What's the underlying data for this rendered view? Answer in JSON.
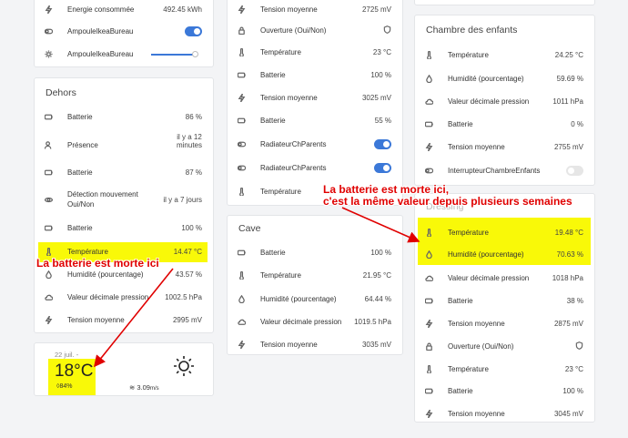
{
  "annotations": {
    "left": "La batterie est morte ici",
    "right_line1": "La batterie est morte ici,",
    "right_line2": "c'est la même valeur depuis plusieurs semaines"
  },
  "col1_top": [
    {
      "icon": "bolt-icon",
      "label": "Energie consommée",
      "value": "492.45 kWh"
    },
    {
      "icon": "toggle-icon",
      "label": "AmpouleIkeaBureau",
      "toggle": "on"
    },
    {
      "icon": "sun-icon",
      "label": "AmpouleIkeaBureau",
      "slider": true
    }
  ],
  "dehors": {
    "title": "Dehors",
    "rows": [
      {
        "icon": "battery-icon",
        "label": "Batterie",
        "value": "86 %"
      },
      {
        "icon": "people-icon",
        "label": "Présence",
        "value1": "il y a 12",
        "value2": "minutes"
      },
      {
        "icon": "battery-icon",
        "label": "Batterie",
        "value": "87 %"
      },
      {
        "icon": "eye-icon",
        "label1": "Détection mouvement",
        "label2": "Oui/Non",
        "value": "il y a 7 jours"
      },
      {
        "icon": "battery-icon",
        "label": "Batterie",
        "value": "100 %"
      },
      {
        "icon": "thermometer-icon",
        "label": "Température",
        "value": "14.47 °C"
      },
      {
        "icon": "drop-icon",
        "label": "Humidité (pourcentage)",
        "value": "43.57 %"
      },
      {
        "icon": "cloud-icon",
        "label": "Valeur décimale pression",
        "value": "1002.5 hPa"
      },
      {
        "icon": "bolt-icon",
        "label": "Tension moyenne",
        "value": "2995 mV"
      }
    ]
  },
  "weather": {
    "date": "22 juil. -",
    "temp": "18°C",
    "humidity": "84%",
    "wind": "3.09",
    "wind_unit": "m/s"
  },
  "col2_top": [
    {
      "icon": "bolt-icon",
      "label": "Tension moyenne",
      "value": "2725 mV"
    },
    {
      "icon": "lock-icon",
      "label": "Ouverture (Oui/Non)",
      "shield": true
    },
    {
      "icon": "thermometer-icon",
      "label": "Température",
      "value": "23 °C"
    },
    {
      "icon": "battery-icon",
      "label": "Batterie",
      "value": "100 %"
    },
    {
      "icon": "bolt-icon",
      "label": "Tension moyenne",
      "value": "3025 mV"
    },
    {
      "icon": "battery-icon",
      "label": "Batterie",
      "value": "55 %"
    },
    {
      "icon": "toggle-icon",
      "label": "RadiateurChParents",
      "toggle": "on"
    },
    {
      "icon": "toggle-icon",
      "label": "RadiateurChParents",
      "toggle": "on"
    },
    {
      "icon": "thermometer-icon",
      "label": "Température",
      "value": ""
    }
  ],
  "cave": {
    "title": "Cave",
    "rows": [
      {
        "icon": "battery-icon",
        "label": "Batterie",
        "value": "100 %"
      },
      {
        "icon": "thermometer-icon",
        "label": "Température",
        "value": "21.95 °C"
      },
      {
        "icon": "drop-icon",
        "label": "Humidité (pourcentage)",
        "value": "64.44 %"
      },
      {
        "icon": "cloud-icon",
        "label": "Valeur décimale pression",
        "value": "1019.5 hPa"
      },
      {
        "icon": "bolt-icon",
        "label": "Tension moyenne",
        "value": "3035 mV"
      }
    ]
  },
  "chambre": {
    "title": "Chambre des enfants",
    "rows": [
      {
        "icon": "thermometer-icon",
        "label": "Température",
        "value": "24.25 °C"
      },
      {
        "icon": "drop-icon",
        "label": "Humidité (pourcentage)",
        "value": "59.69 %"
      },
      {
        "icon": "cloud-icon",
        "label": "Valeur décimale pression",
        "value": "1011 hPa"
      },
      {
        "icon": "battery-icon",
        "label": "Batterie",
        "value": "0 %"
      },
      {
        "icon": "bolt-icon",
        "label": "Tension moyenne",
        "value": "2755 mV"
      },
      {
        "icon": "toggle-icon",
        "label": "InterrupteurChambreEnfants",
        "toggle": "off"
      }
    ]
  },
  "col3_bottom": {
    "title": "Dressing",
    "rows": [
      {
        "icon": "thermometer-icon",
        "label": "Température",
        "value": "19.48 °C"
      },
      {
        "icon": "drop-icon",
        "label": "Humidité (pourcentage)",
        "value": "70.63 %"
      },
      {
        "icon": "cloud-icon",
        "label": "Valeur décimale pression",
        "value": "1018 hPa"
      },
      {
        "icon": "battery-icon",
        "label": "Batterie",
        "value": "38 %"
      },
      {
        "icon": "bolt-icon",
        "label": "Tension moyenne",
        "value": "2875 mV"
      },
      {
        "icon": "lock-icon",
        "label": "Ouverture (Oui/Non)",
        "shield": true
      },
      {
        "icon": "thermometer-icon",
        "label": "Température",
        "value": "23 °C"
      },
      {
        "icon": "battery-icon",
        "label": "Batterie",
        "value": "100 %"
      },
      {
        "icon": "bolt-icon",
        "label": "Tension moyenne",
        "value": "3045 mV"
      }
    ]
  },
  "colors": {
    "highlight": "#f9f908",
    "accent": "#3b78d8",
    "annotation": "#e00000"
  }
}
